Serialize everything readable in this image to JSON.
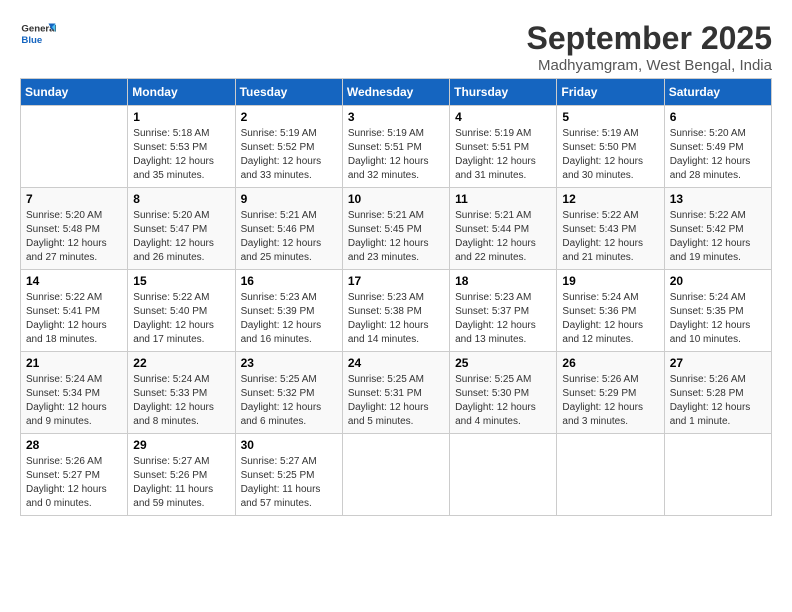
{
  "header": {
    "logo_line1": "General",
    "logo_line2": "Blue",
    "month": "September 2025",
    "location": "Madhyamgram, West Bengal, India"
  },
  "days_of_week": [
    "Sunday",
    "Monday",
    "Tuesday",
    "Wednesday",
    "Thursday",
    "Friday",
    "Saturday"
  ],
  "weeks": [
    [
      {
        "day": "",
        "info": ""
      },
      {
        "day": "1",
        "info": "Sunrise: 5:18 AM\nSunset: 5:53 PM\nDaylight: 12 hours\nand 35 minutes."
      },
      {
        "day": "2",
        "info": "Sunrise: 5:19 AM\nSunset: 5:52 PM\nDaylight: 12 hours\nand 33 minutes."
      },
      {
        "day": "3",
        "info": "Sunrise: 5:19 AM\nSunset: 5:51 PM\nDaylight: 12 hours\nand 32 minutes."
      },
      {
        "day": "4",
        "info": "Sunrise: 5:19 AM\nSunset: 5:51 PM\nDaylight: 12 hours\nand 31 minutes."
      },
      {
        "day": "5",
        "info": "Sunrise: 5:19 AM\nSunset: 5:50 PM\nDaylight: 12 hours\nand 30 minutes."
      },
      {
        "day": "6",
        "info": "Sunrise: 5:20 AM\nSunset: 5:49 PM\nDaylight: 12 hours\nand 28 minutes."
      }
    ],
    [
      {
        "day": "7",
        "info": "Sunrise: 5:20 AM\nSunset: 5:48 PM\nDaylight: 12 hours\nand 27 minutes."
      },
      {
        "day": "8",
        "info": "Sunrise: 5:20 AM\nSunset: 5:47 PM\nDaylight: 12 hours\nand 26 minutes."
      },
      {
        "day": "9",
        "info": "Sunrise: 5:21 AM\nSunset: 5:46 PM\nDaylight: 12 hours\nand 25 minutes."
      },
      {
        "day": "10",
        "info": "Sunrise: 5:21 AM\nSunset: 5:45 PM\nDaylight: 12 hours\nand 23 minutes."
      },
      {
        "day": "11",
        "info": "Sunrise: 5:21 AM\nSunset: 5:44 PM\nDaylight: 12 hours\nand 22 minutes."
      },
      {
        "day": "12",
        "info": "Sunrise: 5:22 AM\nSunset: 5:43 PM\nDaylight: 12 hours\nand 21 minutes."
      },
      {
        "day": "13",
        "info": "Sunrise: 5:22 AM\nSunset: 5:42 PM\nDaylight: 12 hours\nand 19 minutes."
      }
    ],
    [
      {
        "day": "14",
        "info": "Sunrise: 5:22 AM\nSunset: 5:41 PM\nDaylight: 12 hours\nand 18 minutes."
      },
      {
        "day": "15",
        "info": "Sunrise: 5:22 AM\nSunset: 5:40 PM\nDaylight: 12 hours\nand 17 minutes."
      },
      {
        "day": "16",
        "info": "Sunrise: 5:23 AM\nSunset: 5:39 PM\nDaylight: 12 hours\nand 16 minutes."
      },
      {
        "day": "17",
        "info": "Sunrise: 5:23 AM\nSunset: 5:38 PM\nDaylight: 12 hours\nand 14 minutes."
      },
      {
        "day": "18",
        "info": "Sunrise: 5:23 AM\nSunset: 5:37 PM\nDaylight: 12 hours\nand 13 minutes."
      },
      {
        "day": "19",
        "info": "Sunrise: 5:24 AM\nSunset: 5:36 PM\nDaylight: 12 hours\nand 12 minutes."
      },
      {
        "day": "20",
        "info": "Sunrise: 5:24 AM\nSunset: 5:35 PM\nDaylight: 12 hours\nand 10 minutes."
      }
    ],
    [
      {
        "day": "21",
        "info": "Sunrise: 5:24 AM\nSunset: 5:34 PM\nDaylight: 12 hours\nand 9 minutes."
      },
      {
        "day": "22",
        "info": "Sunrise: 5:24 AM\nSunset: 5:33 PM\nDaylight: 12 hours\nand 8 minutes."
      },
      {
        "day": "23",
        "info": "Sunrise: 5:25 AM\nSunset: 5:32 PM\nDaylight: 12 hours\nand 6 minutes."
      },
      {
        "day": "24",
        "info": "Sunrise: 5:25 AM\nSunset: 5:31 PM\nDaylight: 12 hours\nand 5 minutes."
      },
      {
        "day": "25",
        "info": "Sunrise: 5:25 AM\nSunset: 5:30 PM\nDaylight: 12 hours\nand 4 minutes."
      },
      {
        "day": "26",
        "info": "Sunrise: 5:26 AM\nSunset: 5:29 PM\nDaylight: 12 hours\nand 3 minutes."
      },
      {
        "day": "27",
        "info": "Sunrise: 5:26 AM\nSunset: 5:28 PM\nDaylight: 12 hours\nand 1 minute."
      }
    ],
    [
      {
        "day": "28",
        "info": "Sunrise: 5:26 AM\nSunset: 5:27 PM\nDaylight: 12 hours\nand 0 minutes."
      },
      {
        "day": "29",
        "info": "Sunrise: 5:27 AM\nSunset: 5:26 PM\nDaylight: 11 hours\nand 59 minutes."
      },
      {
        "day": "30",
        "info": "Sunrise: 5:27 AM\nSunset: 5:25 PM\nDaylight: 11 hours\nand 57 minutes."
      },
      {
        "day": "",
        "info": ""
      },
      {
        "day": "",
        "info": ""
      },
      {
        "day": "",
        "info": ""
      },
      {
        "day": "",
        "info": ""
      }
    ]
  ]
}
